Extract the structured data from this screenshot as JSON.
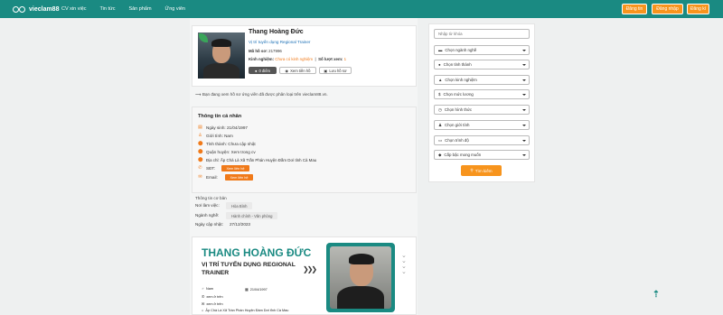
{
  "header": {
    "logo_text": "vieclam88",
    "nav": [
      "CV xin việc",
      "Tin tức",
      "Sản phẩm",
      "Ứng viên"
    ],
    "buttons": [
      "Đăng tin",
      "Đăng nhập",
      "Đăng kí"
    ]
  },
  "profile": {
    "name": "Thang Hoàng Đức",
    "position": "Vị trí tuyển dụng Regional Trainer",
    "code_label": "Mã hồ sơ:",
    "code_value": "217996",
    "exp_label": "Kinh nghiệm:",
    "exp_value": "Chưa có kinh nghiệm",
    "views_label": "Số lượt xem:",
    "views_value": "1",
    "save_label": "0 điểm",
    "view_more": "Xem tiền hồ",
    "save_profile": "Lưu hồ sơ",
    "notice": "Bạn đang xem hồ sơ ứng viên đã được phân loại trên vieclam88.vn."
  },
  "personal": {
    "title": "Thông tin cá nhân",
    "dob": "Ngày sinh: 21/04/1997",
    "gender": "Giới tính: Nam",
    "province": "Tỉnh thành: Chưa cập nhật",
    "district": "Quận huyện: Xem trong cv",
    "address": "Địa chỉ: Ấp Chà Là Xã Trần Phán Huyện Đầm Dơi tỉnh Cà Mau",
    "phone_label": "SĐT:",
    "email_label": "Email:",
    "reveal": "Xem liên hệ"
  },
  "basic": {
    "title": "Thông tin cơ bản",
    "workplace_label": "Nơi làm việc:",
    "workplace": "Hòa Bình",
    "industry_label": "Ngành nghề:",
    "industry": "Hành chính - Văn phòng",
    "updated_label": "Ngày cập nhật:",
    "updated": "27/12/2023"
  },
  "filters": {
    "keyword_placeholder": "Nhập từ khóa",
    "items": [
      "Chọn ngành nghề",
      "Chọn tỉnh thành",
      "Chọn kinh nghiệm",
      "Chọn mức lương",
      "Chọn hình thức",
      "Chọn giới tính",
      "Chọn trình độ",
      "Cấp bậc mong muốn"
    ],
    "icons": [
      "briefcase-icon",
      "location-icon",
      "graduation-icon",
      "money-icon",
      "clock-icon",
      "user-icon",
      "book-icon",
      "level-icon"
    ],
    "search": "Tìm kiếm"
  },
  "banner": {
    "name": "THANG HOÀNG ĐỨC",
    "role": "VỊ TRÍ TUYỂN DỤNG REGIONAL TRAINER",
    "gender": "Nam",
    "dob": "21/04/1997",
    "phone": "xem ở trên",
    "email": "xem ở trên",
    "address": "Ấp Chà Là Xã Trần Phán Huyện Đầm Dơi tỉnh Cà Mau"
  },
  "colors": {
    "brand": "#1a8a82",
    "accent": "#f7941d"
  }
}
